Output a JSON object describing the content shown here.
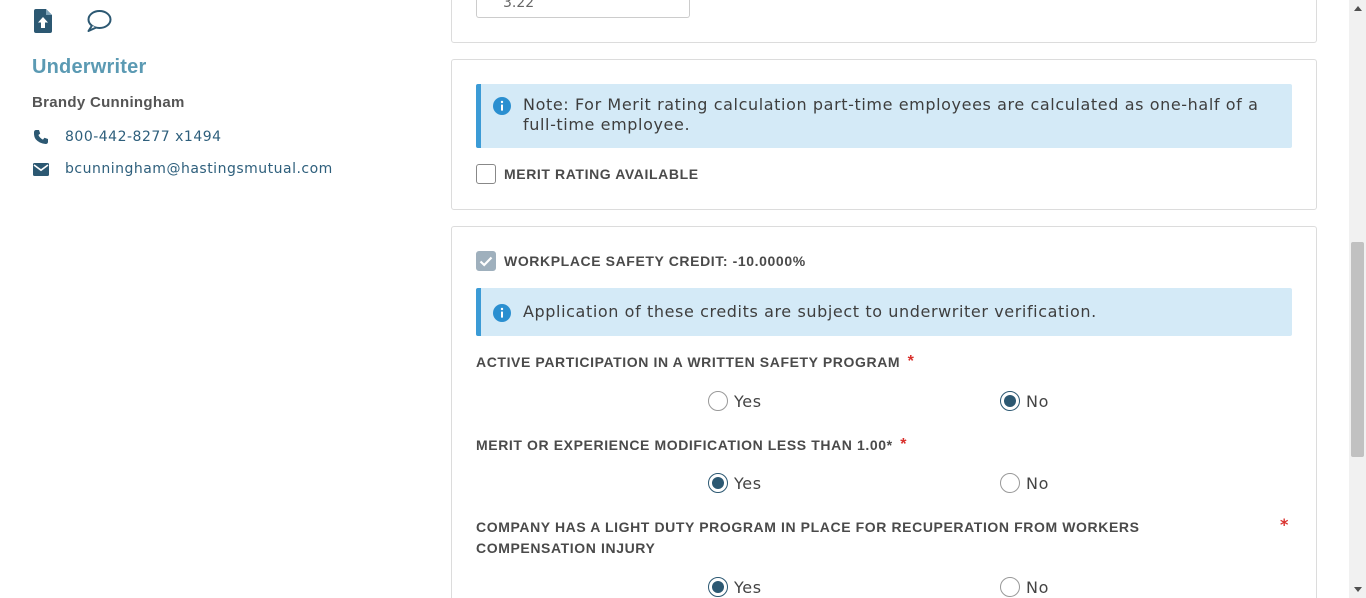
{
  "sidebar": {
    "icons": [
      "upload-file-icon",
      "chat-bubble-icon"
    ],
    "title": "Underwriter",
    "name": "Brandy Cunningham",
    "phone": "800-442-8277 x1494",
    "email": "bcunningham@hastingsmutual.com"
  },
  "card1": {
    "partial_value": "3.22"
  },
  "merit": {
    "note": "Note: For Merit rating calculation part-time employees are calculated as one-half of a full-time employee.",
    "checkbox_label": "MERIT RATING AVAILABLE",
    "checked": false
  },
  "safety": {
    "checkbox_label": "WORKPLACE SAFETY CREDIT: -10.0000%",
    "checked": true,
    "note": "Application of these credits are subject to underwriter verification.",
    "questions": [
      {
        "label": "ACTIVE PARTICIPATION IN A WRITTEN SAFETY PROGRAM",
        "required": "*",
        "options": [
          "Yes",
          "No"
        ],
        "selected": "No"
      },
      {
        "label": "MERIT OR EXPERIENCE MODIFICATION LESS THAN 1.00*",
        "required": "*",
        "options": [
          "Yes",
          "No"
        ],
        "selected": "Yes"
      },
      {
        "label": "COMPANY HAS A LIGHT DUTY PROGRAM IN PLACE FOR RECUPERATION FROM WORKERS COMPENSATION INJURY",
        "required": "*",
        "options": [
          "Yes",
          "No"
        ],
        "selected": "Yes"
      }
    ]
  },
  "colors": {
    "accent_title": "#5b9ab3",
    "link": "#2e5f7c",
    "info_bg": "#d4eaf7",
    "info_border": "#3b9bd6",
    "radio_selected": "#2c5872",
    "required": "#d9302c"
  }
}
